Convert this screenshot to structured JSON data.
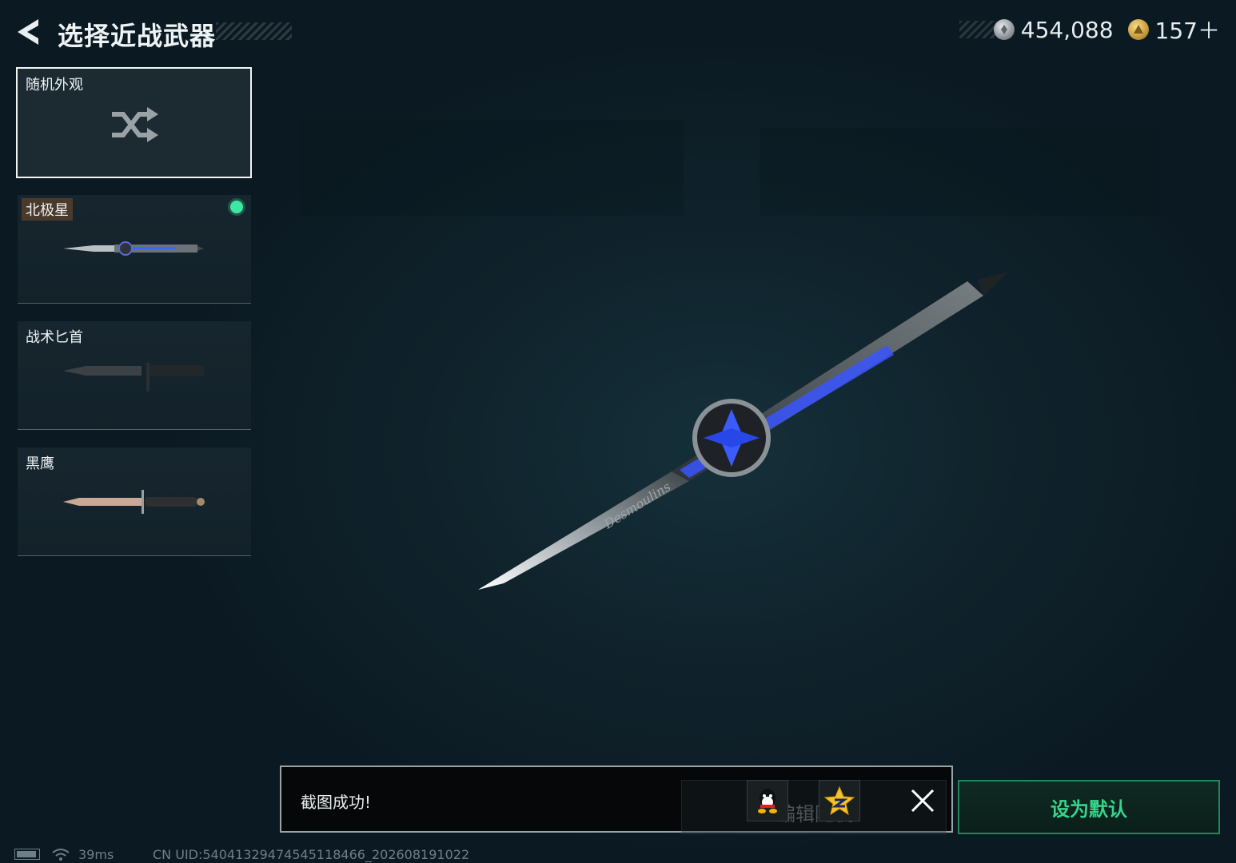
{
  "header": {
    "title": "选择近战武器",
    "currencies": [
      {
        "icon": "silver-coin-icon",
        "value": "454,088"
      },
      {
        "icon": "gold-coin-icon",
        "value": "157＋"
      }
    ]
  },
  "weapon_list": {
    "random": {
      "label": "随机外观",
      "icon": "shuffle-icon"
    },
    "items": [
      {
        "label": "北极星",
        "equipped": true
      },
      {
        "label": "战术匕首",
        "equipped": false
      },
      {
        "label": "黑鹰",
        "equipped": false
      }
    ]
  },
  "preview": {
    "engraving": "Desmoulins"
  },
  "toast": {
    "message": "截图成功!",
    "edit_label": "编辑随机",
    "share_targets": [
      "qq-icon",
      "qzone-star-icon"
    ]
  },
  "actions": {
    "set_default": "设为默认"
  },
  "status_bar": {
    "ping": "39ms",
    "uid": "CN UID:5404132947454511846­6_202608191022"
  },
  "colors": {
    "accent_green": "#37d38b",
    "equipped_dot": "#3ee8a0",
    "background": "#0c1a22"
  }
}
